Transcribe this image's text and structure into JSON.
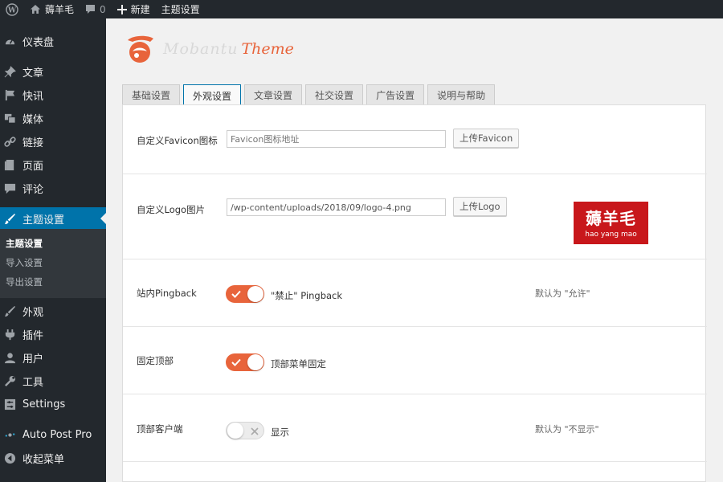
{
  "admin_bar": {
    "site_name": "薅羊毛",
    "comment_count": "0",
    "new_label": "新建",
    "theme_settings_label": "主题设置"
  },
  "sidebar": {
    "items": [
      {
        "label": "仪表盘",
        "icon": "dashboard-icon"
      },
      {
        "label": "文章",
        "icon": "pin-icon"
      },
      {
        "label": "快讯",
        "icon": "flag-icon"
      },
      {
        "label": "媒体",
        "icon": "media-icon"
      },
      {
        "label": "链接",
        "icon": "link-icon"
      },
      {
        "label": "页面",
        "icon": "page-icon"
      },
      {
        "label": "评论",
        "icon": "comment-icon"
      },
      {
        "label": "主题设置",
        "icon": "brush-icon"
      },
      {
        "label": "外观",
        "icon": "appearance-icon"
      },
      {
        "label": "插件",
        "icon": "plugin-icon"
      },
      {
        "label": "用户",
        "icon": "user-icon"
      },
      {
        "label": "工具",
        "icon": "wrench-icon"
      },
      {
        "label": "Settings",
        "icon": "settings-icon"
      },
      {
        "label": "Auto Post Pro",
        "icon": "autopost-icon"
      },
      {
        "label": "收起菜单",
        "icon": "collapse-icon"
      }
    ],
    "submenu": [
      "主题设置",
      "导入设置",
      "导出设置"
    ]
  },
  "logo": {
    "brand_a": "Mobantu",
    "brand_b": "Theme",
    "accent": "#e8643b"
  },
  "tabs": [
    "基础设置",
    "外观设置",
    "文章设置",
    "社交设置",
    "广告设置",
    "说明与帮助"
  ],
  "active_tab": "外观设置",
  "settings": {
    "favicon": {
      "label": "自定义Favicon图标",
      "placeholder": "Favicon图标地址",
      "button": "上传Favicon"
    },
    "logo_image": {
      "label": "自定义Logo图片",
      "value": "/wp-content/uploads/2018/09/logo-4.png",
      "button": "上传Logo",
      "preview_big": "薅羊毛",
      "preview_small": "hao yang mao"
    },
    "pingback": {
      "label": "站内Pingback",
      "option": "\"禁止\" Pingback",
      "hint": "默认为 \"允许\"",
      "enabled": true
    },
    "fixed_top": {
      "label": "固定顶部",
      "option": "顶部菜单固定",
      "enabled": true
    },
    "top_client": {
      "label": "顶部客户端",
      "option": "显示",
      "hint": "默认为 \"不显示\"",
      "enabled": false
    }
  },
  "colors": {
    "admin_bg": "#23282d",
    "active_blue": "#0073aa",
    "toggle_on": "#e8643b"
  }
}
